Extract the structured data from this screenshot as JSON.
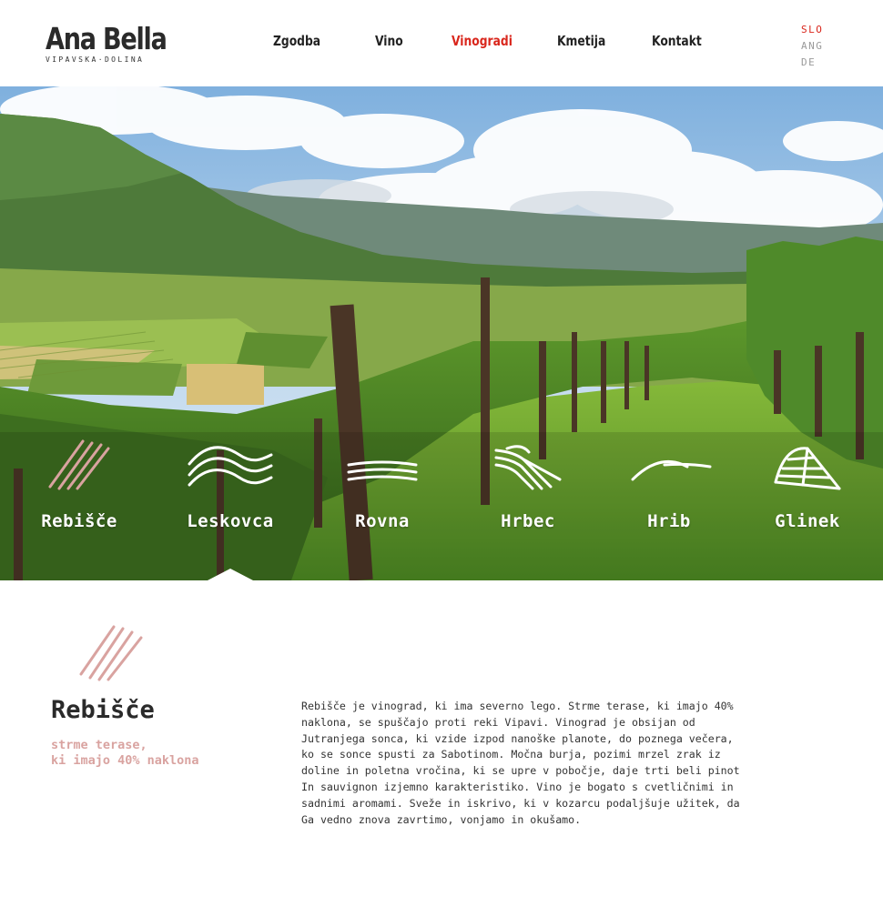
{
  "brand": {
    "title": "Ana Bella",
    "subtitle": "VIPAVSKA·DOLINA"
  },
  "nav": {
    "items": [
      {
        "label": "Zgodba",
        "active": false
      },
      {
        "label": "Vino",
        "active": false
      },
      {
        "label": "Vinogradi",
        "active": true
      },
      {
        "label": "Kmetija",
        "active": false
      },
      {
        "label": "Kontakt",
        "active": false
      }
    ]
  },
  "languages": [
    {
      "label": "SLO",
      "active": true
    },
    {
      "label": "ANG",
      "active": false
    },
    {
      "label": "DE",
      "active": false
    }
  ],
  "vineyards": [
    {
      "name": "Rebišče",
      "icon": "diagonal-lines-icon",
      "selected": true
    },
    {
      "name": "Leskovca",
      "icon": "wave-lines-icon",
      "selected": false
    },
    {
      "name": "Rovna",
      "icon": "flat-lines-icon",
      "selected": false
    },
    {
      "name": "Hrbec",
      "icon": "ridge-lines-icon",
      "selected": false
    },
    {
      "name": "Hrib",
      "icon": "hill-line-icon",
      "selected": false
    },
    {
      "name": "Glinek",
      "icon": "tent-lines-icon",
      "selected": false
    }
  ],
  "detail": {
    "icon": "diagonal-lines-icon",
    "title": "Rebišče",
    "subtitle_lines": [
      "strme terase,",
      "ki imajo 40% naklona"
    ],
    "text_lines": [
      "Rebišče je vinograd, ki ima severno lego. Strme terase, ki imajo 40%",
      "naklona, se spuščajo proti reki Vipavi. Vinograd je obsijan od",
      "Jutranjega sonca, ki vzide izpod nanoške planote, do poznega večera,",
      "ko se sonce spusti za Sabotinom. Močna burja, pozimi mrzel zrak iz",
      "doline in poletna vročina, ki se upre v pobočje, daje trti beli pinot",
      "In sauvignon izjemno karakteristiko. Vino je bogato s cvetličnimi in",
      "sadnimi aromami. Sveže in iskrivo, ki v kozarcu podaljšuje užitek, da",
      "Ga vedno znova zavrtimo, vonjamo in okušamo."
    ]
  },
  "colors": {
    "accent": "#d9261c",
    "icon_pink": "#d9a3a0",
    "text_dark": "#2a2a2a"
  }
}
